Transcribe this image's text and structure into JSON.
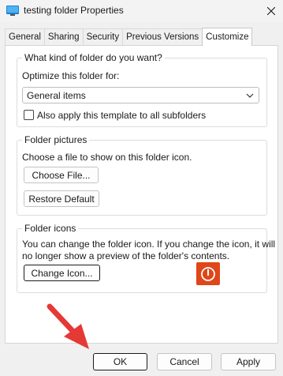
{
  "window": {
    "title": "testing folder Properties",
    "close_icon": "close-icon",
    "app_icon": "folder-window-icon"
  },
  "tabs": [
    {
      "label": "General",
      "active": false
    },
    {
      "label": "Sharing",
      "active": false
    },
    {
      "label": "Security",
      "active": false
    },
    {
      "label": "Previous Versions",
      "active": false
    },
    {
      "label": "Customize",
      "active": true
    }
  ],
  "folder_type": {
    "heading": "What kind of folder do you want?",
    "optimize_label": "Optimize this folder for:",
    "selected": "General items",
    "apply_subfolders_label": "Also apply this template to all subfolders",
    "apply_subfolders_checked": false
  },
  "folder_pictures": {
    "heading": "Folder pictures",
    "description": "Choose a file to show on this folder icon.",
    "choose_file_label": "Choose File...",
    "restore_default_label": "Restore Default"
  },
  "folder_icons": {
    "heading": "Folder icons",
    "description_line1": "You can change the folder icon. If you change the icon, it will",
    "description_line2": "no longer show a preview of the folder's contents.",
    "change_icon_label": "Change Icon...",
    "preview_icon": "power-icon",
    "preview_color": "#e0461a"
  },
  "footer": {
    "ok_label": "OK",
    "cancel_label": "Cancel",
    "apply_label": "Apply"
  },
  "annotation": {
    "arrow_icon": "red-arrow-icon",
    "arrow_color": "#e53935"
  }
}
